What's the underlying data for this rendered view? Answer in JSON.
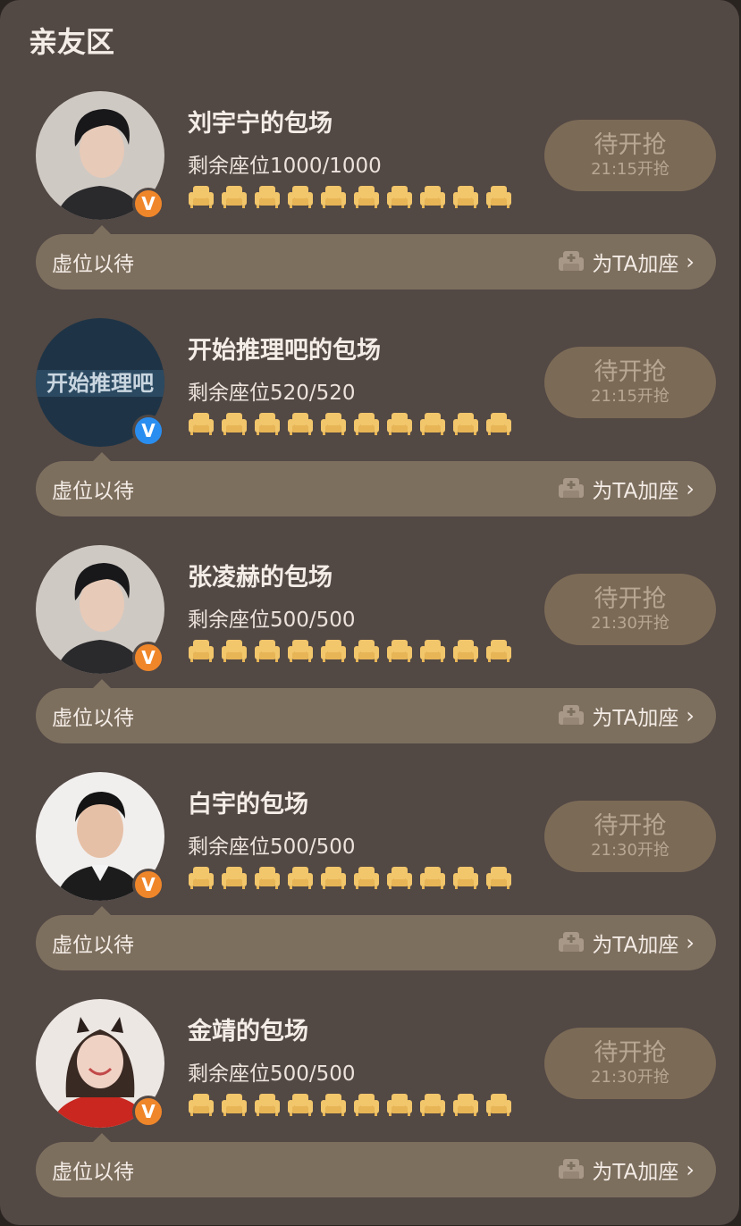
{
  "section": {
    "title": "亲友区"
  },
  "cards": [
    {
      "name": "刘宇宁的包场",
      "seats": "剩余座位1000/1000",
      "button": "待开抢",
      "time": "21:15开抢",
      "bar_label": "虚位以待",
      "add_label": "为TA加座",
      "badge_color": "#f0862a",
      "avatar": "man-dark-hair"
    },
    {
      "name": "开始推理吧的包场",
      "seats": "剩余座位520/520",
      "button": "待开抢",
      "time": "21:15开抢",
      "bar_label": "虚位以待",
      "add_label": "为TA加座",
      "badge_color": "#2a8ef0",
      "avatar": "show-logo",
      "logo_text": "开始推理吧"
    },
    {
      "name": "张凌赫的包场",
      "seats": "剩余座位500/500",
      "button": "待开抢",
      "time": "21:30开抢",
      "bar_label": "虚位以待",
      "add_label": "为TA加座",
      "badge_color": "#f0862a",
      "avatar": "man-dark-hair"
    },
    {
      "name": "白宇的包场",
      "seats": "剩余座位500/500",
      "button": "待开抢",
      "time": "21:30开抢",
      "bar_label": "虚位以待",
      "add_label": "为TA加座",
      "badge_color": "#f0862a",
      "avatar": "man-suit"
    },
    {
      "name": "金靖的包场",
      "seats": "剩余座位500/500",
      "button": "待开抢",
      "time": "21:30开抢",
      "bar_label": "虚位以待",
      "add_label": "为TA加座",
      "badge_color": "#f0862a",
      "avatar": "woman-red"
    }
  ],
  "icons": {
    "seat": "sofa-icon",
    "add_seat": "sofa-plus-icon",
    "verified": "verified-v-icon",
    "chevron": "chevron-right-icon"
  },
  "colors": {
    "seat_gold": "#f2c66b",
    "verified_orange": "#f0862a",
    "verified_blue": "#2a8ef0"
  }
}
